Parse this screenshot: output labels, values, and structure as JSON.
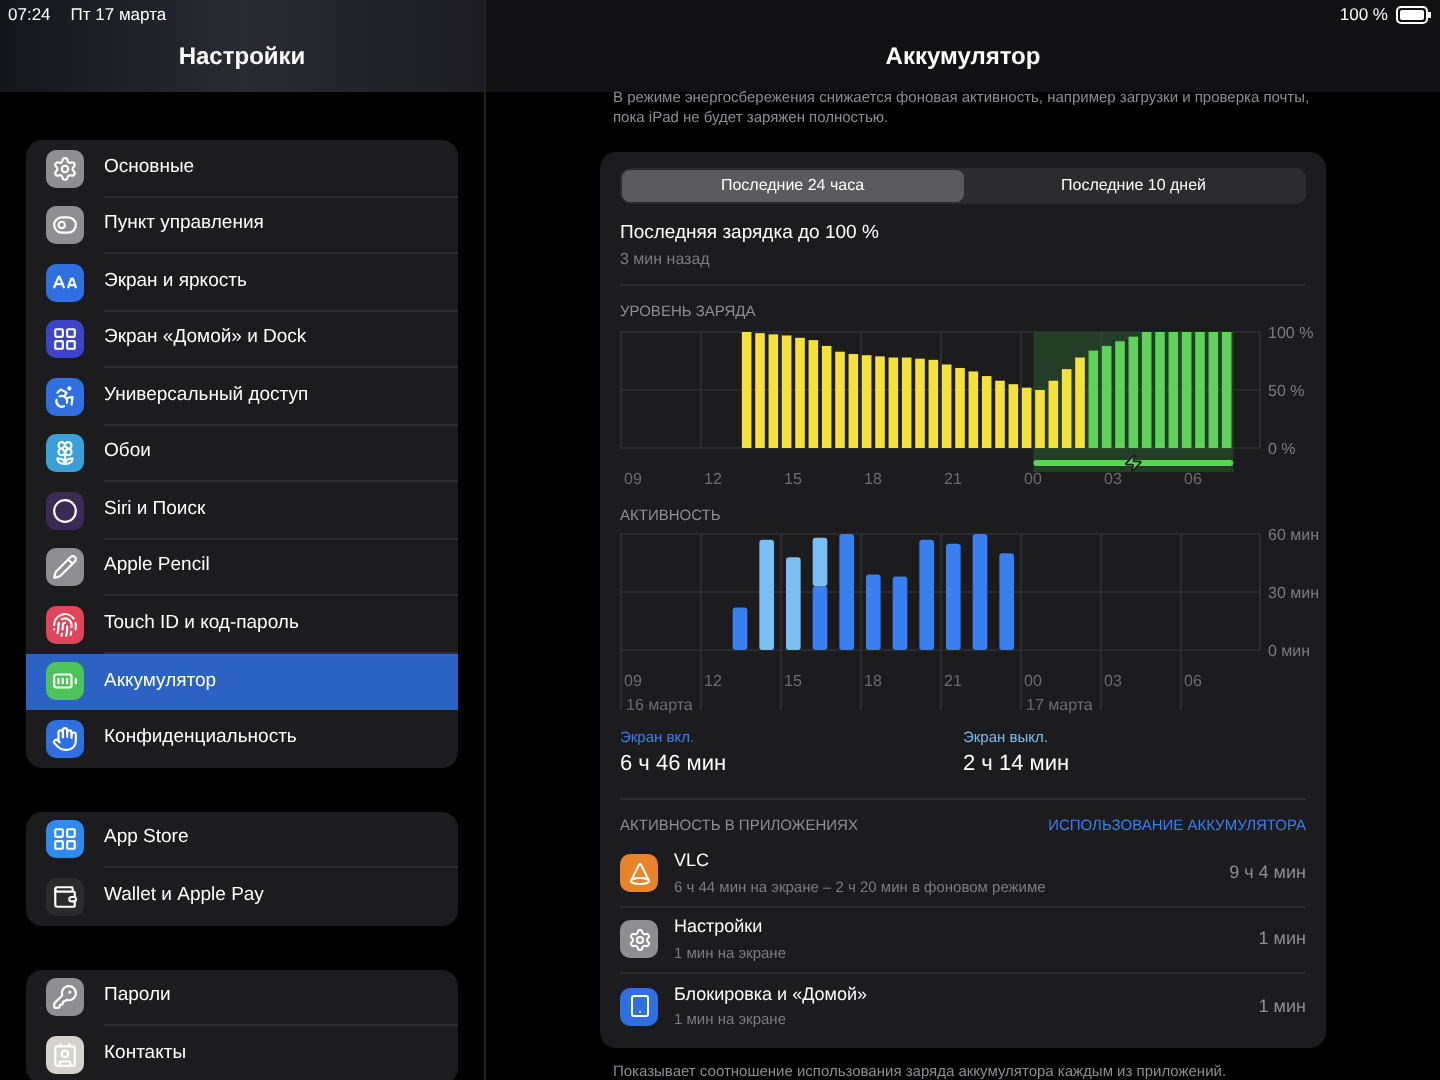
{
  "status_bar": {
    "time": "07:24",
    "date": "Пт 17 марта",
    "battery": "100 %"
  },
  "sidebar": {
    "title": "Настройки",
    "groups": [
      {
        "items": [
          {
            "label": "Основные",
            "selected": false
          },
          {
            "label": "Пункт управления",
            "selected": false
          },
          {
            "label": "Экран и яркость",
            "selected": false
          },
          {
            "label": "Экран «Домой» и Dock",
            "selected": false
          },
          {
            "label": "Универсальный доступ",
            "selected": false
          },
          {
            "label": "Обои",
            "selected": false
          },
          {
            "label": "Siri и Поиск",
            "selected": false
          },
          {
            "label": "Apple Pencil",
            "selected": false
          },
          {
            "label": "Touch ID и код-пароль",
            "selected": false
          },
          {
            "label": "Аккумулятор",
            "selected": true
          },
          {
            "label": "Конфиденциальность",
            "selected": false
          }
        ]
      },
      {
        "items": [
          {
            "label": "App Store",
            "selected": false
          },
          {
            "label": "Wallet и Apple Pay",
            "selected": false
          }
        ]
      },
      {
        "items": [
          {
            "label": "Пароли",
            "selected": false
          },
          {
            "label": "Контакты",
            "selected": false
          }
        ]
      }
    ]
  },
  "main": {
    "title": "Аккумулятор",
    "intro": "В режиме энергосбережения снижается фоновая активность, например загрузки и проверка почты, пока iPad не будет заряжен полностью.",
    "tabs": [
      {
        "label": "Последние 24 часа",
        "selected": true
      },
      {
        "label": "Последние 10 дней",
        "selected": false
      }
    ],
    "last_charge": {
      "title": "Последняя зарядка до 100 %",
      "time": "3 мин назад"
    },
    "battery_chart": {
      "heading": "УРОВЕНЬ ЗАРЯДА",
      "chart_data": {
        "type": "bar",
        "stacked": false,
        "categories": [
          "09",
          null,
          null,
          null,
          null,
          null,
          "12",
          null,
          null,
          null,
          null,
          null,
          "15",
          null,
          null,
          null,
          null,
          null,
          "18",
          null,
          null,
          null,
          null,
          null,
          "21",
          null,
          null,
          null,
          null,
          null,
          "00",
          null,
          null,
          null,
          null,
          null,
          "03",
          null,
          null,
          null,
          null,
          null,
          "06",
          null,
          null,
          null,
          null,
          null
        ],
        "series": [
          {
            "color": "#f5e13c",
            "values": [
              null,
              null,
              null,
              null,
              null,
              null,
              null,
              null,
              null,
              100,
              99,
              98,
              97,
              95,
              93,
              88,
              83,
              81,
              80,
              79,
              78,
              78,
              77,
              76,
              72,
              69,
              66,
              62,
              58,
              55,
              52,
              50,
              58,
              68,
              78,
              null,
              null,
              null,
              null,
              null,
              null,
              null,
              null,
              null,
              null,
              null,
              null,
              null
            ]
          },
          {
            "color": "#5ed35a",
            "values": [
              null,
              null,
              null,
              null,
              null,
              null,
              null,
              null,
              null,
              null,
              null,
              null,
              null,
              null,
              null,
              null,
              null,
              null,
              null,
              null,
              null,
              null,
              null,
              null,
              null,
              null,
              null,
              null,
              null,
              null,
              null,
              null,
              null,
              null,
              null,
              84,
              88,
              92,
              96,
              100,
              100,
              100,
              100,
              100,
              100,
              100,
              null,
              null
            ]
          }
        ],
        "ylim": [
          0,
          100
        ],
        "yticks": [
          {
            "value": 100,
            "label": "100 %"
          },
          {
            "value": 50,
            "label": "50 %"
          },
          {
            "value": 0,
            "label": "0 %"
          }
        ]
      }
    },
    "activity_chart": {
      "heading": "АКТИВНОСТЬ",
      "dates": [
        "16 марта",
        "17 марта"
      ],
      "chart_data": {
        "type": "bar",
        "stacked": true,
        "categories": [
          "09",
          null,
          null,
          "12",
          null,
          null,
          "15",
          null,
          null,
          "18",
          null,
          null,
          "21",
          null,
          null,
          "00",
          null,
          null,
          "03",
          null,
          null,
          "06",
          null,
          null
        ],
        "series": [
          {
            "color": "#3a7ff0",
            "values": [
              null,
              null,
              null,
              null,
              22,
              0,
              0,
              33,
              60,
              39,
              38,
              57,
              55,
              60,
              50,
              null,
              null,
              null,
              null,
              null,
              null,
              null,
              null,
              null
            ]
          },
          {
            "color": "#7bbff2",
            "values": [
              null,
              null,
              null,
              null,
              0,
              57,
              48,
              25,
              0,
              0,
              0,
              0,
              0,
              0,
              0,
              null,
              null,
              null,
              null,
              null,
              null,
              null,
              null,
              null
            ]
          }
        ],
        "ylim": [
          0,
          60
        ],
        "yticks": [
          {
            "value": 60,
            "label": "60 мин"
          },
          {
            "value": 30,
            "label": "30 мин"
          },
          {
            "value": 0,
            "label": "0 мин"
          }
        ]
      }
    },
    "totals": [
      {
        "label": "Экран вкл.",
        "value": "6 ч 46 мин",
        "color": "#3a7ff0"
      },
      {
        "label": "Экран выкл.",
        "value": "2 ч 14 мин",
        "color": "#7bbff2"
      }
    ],
    "apps_heading": "АКТИВНОСТЬ В ПРИЛОЖЕНИЯХ",
    "apps_link": "ИСПОЛЬЗОВАНИЕ АККУМУЛЯТОРА",
    "apps": [
      {
        "name": "VLC",
        "detail": "6 ч 44 мин на экране – 2 ч 20 мин в фоновом режиме",
        "time": "9 ч 4 мин"
      },
      {
        "name": "Настройки",
        "detail": "1 мин на экране",
        "time": "1 мин"
      },
      {
        "name": "Блокировка и «Домой»",
        "detail": "1 мин на экране",
        "time": "1 мин"
      }
    ],
    "footer": "Показывает соотношение использования заряда аккумулятора каждым из приложений."
  }
}
